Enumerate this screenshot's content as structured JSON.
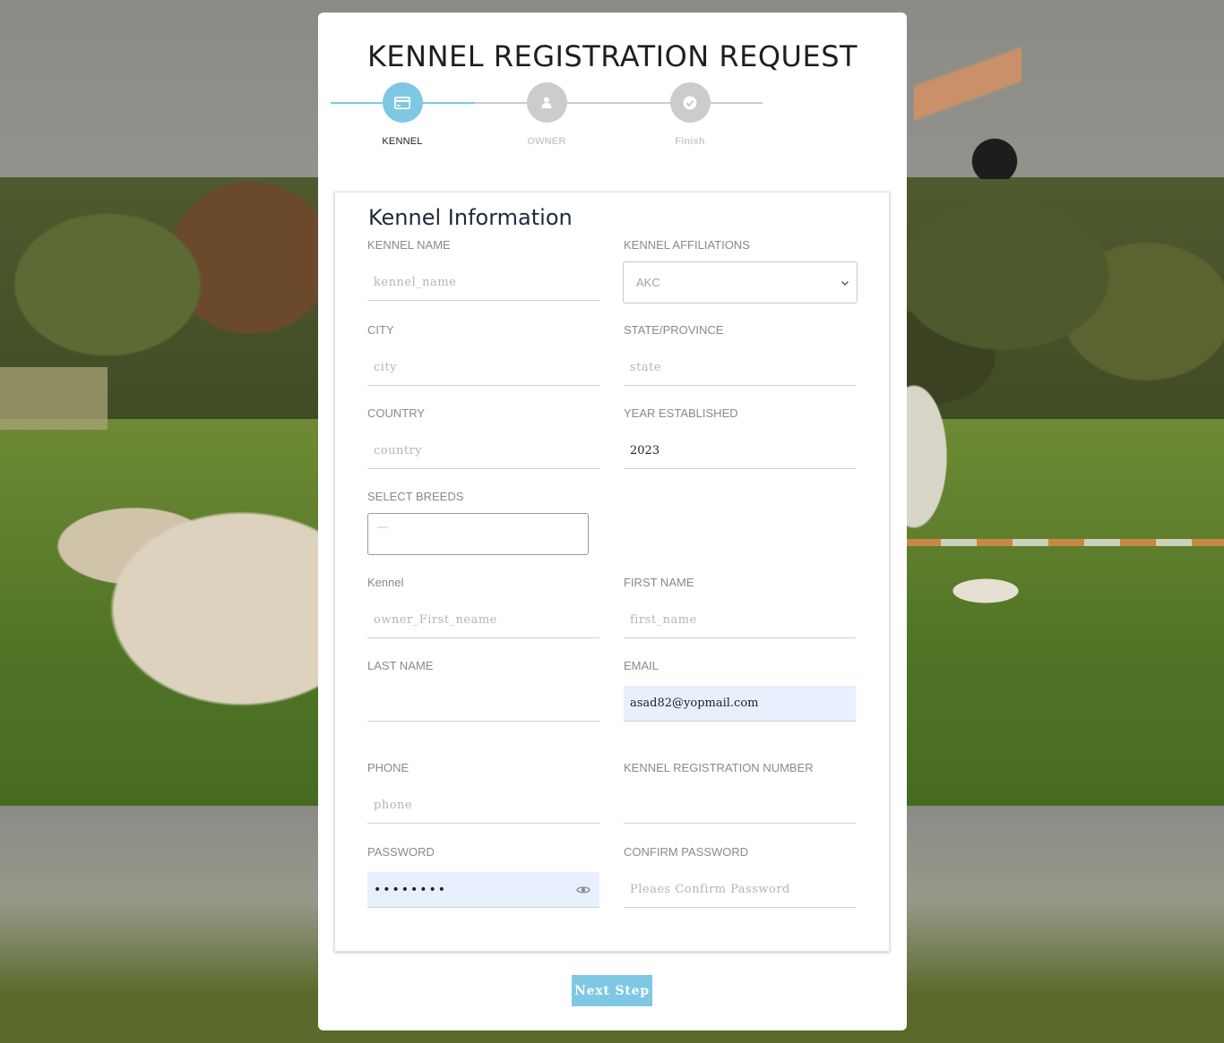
{
  "page": {
    "title": "KENNEL REGISTRATION REQUEST"
  },
  "stepper": {
    "steps": [
      {
        "label": "KENNEL",
        "icon": "credit-card-icon",
        "active": true
      },
      {
        "label": "OWNER",
        "icon": "user-icon",
        "active": false
      },
      {
        "label": "Finish",
        "icon": "check-icon",
        "active": false
      }
    ],
    "accent_color": "#7ec8e3",
    "inactive_color": "#cccccc"
  },
  "form": {
    "section_title": "Kennel Information",
    "kennel_name": {
      "label": "KENNEL NAME",
      "placeholder": "kennel_name",
      "value": ""
    },
    "kennel_affiliations": {
      "label": "KENNEL AFFILIATIONS",
      "selected": "AKC"
    },
    "city": {
      "label": "CITY",
      "placeholder": "city",
      "value": ""
    },
    "state": {
      "label": "STATE/PROVINCE",
      "placeholder": "state",
      "value": ""
    },
    "country": {
      "label": "COUNTRY",
      "placeholder": "country",
      "value": ""
    },
    "year_established": {
      "label": "YEAR ESTABLISHED",
      "placeholder": "",
      "value": "2023"
    },
    "select_breeds": {
      "label": "SELECT BREEDS",
      "placeholder": "—"
    },
    "kennel_owner": {
      "label": "Kennel",
      "placeholder": "owner_First_neame",
      "value": ""
    },
    "first_name": {
      "label": "FIRST NAME",
      "placeholder": "first_name",
      "value": ""
    },
    "last_name": {
      "label": "LAST NAME",
      "placeholder": "",
      "value": ""
    },
    "email": {
      "label": "EMAIL",
      "placeholder": "",
      "value": "asad82@yopmail.com"
    },
    "phone": {
      "label": "PHONE",
      "placeholder": "phone",
      "value": ""
    },
    "registration_number": {
      "label": "KENNEL REGISTRATION NUMBER",
      "placeholder": "",
      "value": ""
    },
    "password": {
      "label": "PASSWORD",
      "value": "••••••••"
    },
    "confirm_password": {
      "label": "CONFIRM PASSWORD",
      "placeholder": "Pleaes Confirm Password",
      "value": ""
    }
  },
  "actions": {
    "next_label": "Next Step"
  }
}
